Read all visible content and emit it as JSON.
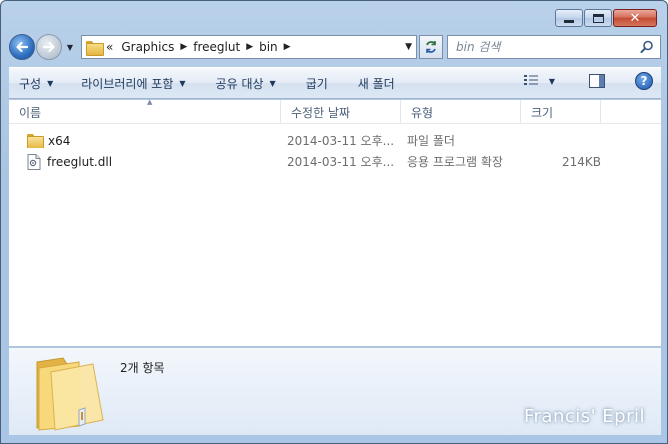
{
  "navigation": {
    "breadcrumb_overflow": "«",
    "breadcrumbs": [
      "Graphics",
      "freeglut",
      "bin"
    ]
  },
  "search": {
    "placeholder": "bin 검색"
  },
  "toolbar": {
    "organize": "구성",
    "include_in_library": "라이브러리에 포함",
    "share_with": "공유 대상",
    "burn": "굽기",
    "new_folder": "새 폴더"
  },
  "columns": {
    "name": "이름",
    "date_modified": "수정한 날짜",
    "type": "유형",
    "size": "크기"
  },
  "files": [
    {
      "name": "x64",
      "date": "2014-03-11 오후...",
      "type": "파일 폴더",
      "size": "",
      "icon": "folder-icon"
    },
    {
      "name": "freeglut.dll",
      "date": "2014-03-11 오후...",
      "type": "응용 프로그램 확장",
      "size": "214KB",
      "icon": "dll-file-icon"
    }
  ],
  "details": {
    "item_count": "2개 항목"
  },
  "watermark": "Francis' Epril",
  "colors": {
    "accent": "#1e395b",
    "frame": "#aac6e6",
    "folder": "#e5b843"
  }
}
